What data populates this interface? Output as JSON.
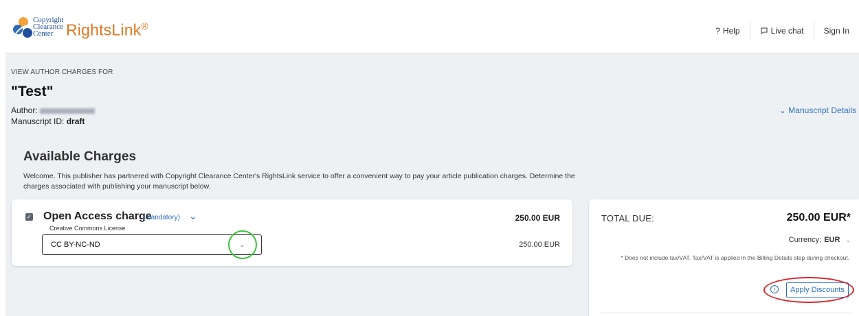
{
  "header": {
    "logo_text_lines": [
      "Copyright",
      "Clearance",
      "Center"
    ],
    "brand": "RightsLink",
    "brand_mark": "®",
    "nav": {
      "help": "Help",
      "live_chat": "Live chat",
      "sign_in": "Sign In"
    }
  },
  "manuscript": {
    "eyebrow": "VIEW AUTHOR CHARGES FOR",
    "title": "\"Test\"",
    "author_label": "Author:",
    "id_label": "Manuscript ID:",
    "id_value": "draft",
    "details_link": "Manuscript Details"
  },
  "charges": {
    "heading": "Available Charges",
    "intro": "Welcome. This publisher has partnered with Copyright Clearance Center's RightsLink service to offer a convenient way to pay your article publication charges. Determine the charges associated with publishing your manuscript below.",
    "item": {
      "checked": true,
      "title": "Open Access charge",
      "tag": "(mandatory)",
      "amount": "250.00 EUR",
      "license_label": "Creative Commons License",
      "license_selected": "CC BY-NC-ND",
      "option_amount": "250.00 EUR"
    }
  },
  "summary": {
    "total_label": "TOTAL DUE:",
    "total_amount": "250.00 EUR*",
    "currency_label": "Currency:",
    "currency_value": "EUR",
    "tax_note": "* Does not include tax/VAT. Tax/VAT is applied in the Billing Details step during checkout.",
    "apply_discounts": "Apply Discounts"
  },
  "icons": {
    "help": "question-icon",
    "chat": "chat-bubble-icon",
    "chevron": "chevron-down-icon",
    "info": "info-icon"
  },
  "colors": {
    "brand_orange": "#e0761f",
    "link_blue": "#2a6fbf",
    "annotation_green": "#3bc43b",
    "annotation_red": "#d9252c"
  }
}
